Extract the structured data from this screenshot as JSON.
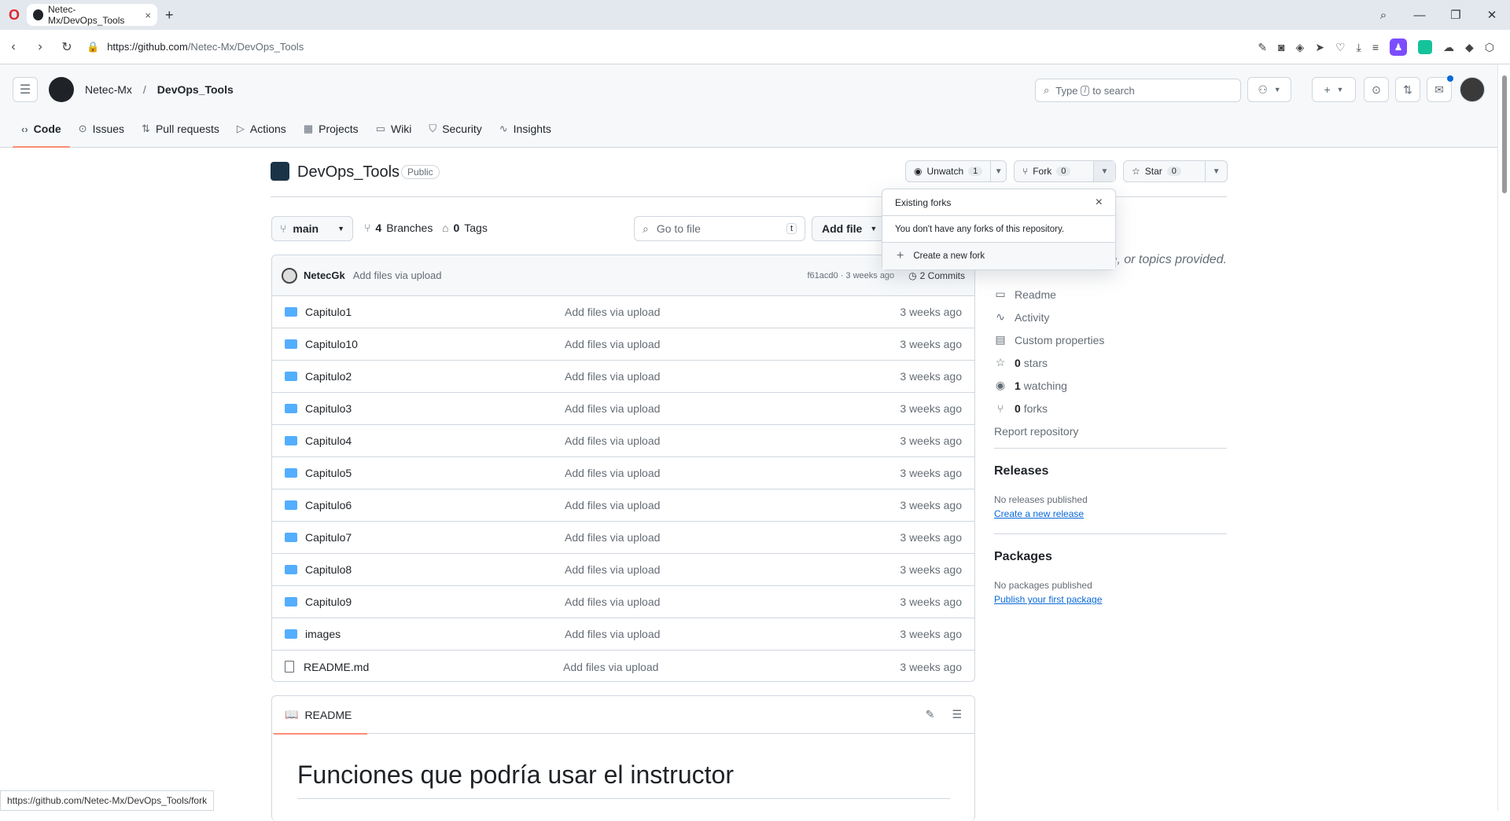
{
  "browser": {
    "tab_title": "Netec-Mx/DevOps_Tools",
    "url_host": "https://github.com",
    "url_path": "/Netec-Mx/DevOps_Tools",
    "status_url": "https://github.com/Netec-Mx/DevOps_Tools/fork"
  },
  "header": {
    "owner": "Netec-Mx",
    "separator": "/",
    "repo": "DevOps_Tools",
    "search_prefix": "Type",
    "search_key": "/",
    "search_suffix": "to search"
  },
  "nav": [
    {
      "label": "Code",
      "icon": "code-icon"
    },
    {
      "label": "Issues",
      "icon": "issue-icon"
    },
    {
      "label": "Pull requests",
      "icon": "pull-request-icon"
    },
    {
      "label": "Actions",
      "icon": "play-icon"
    },
    {
      "label": "Projects",
      "icon": "table-icon"
    },
    {
      "label": "Wiki",
      "icon": "book-icon"
    },
    {
      "label": "Security",
      "icon": "shield-icon"
    },
    {
      "label": "Insights",
      "icon": "graph-icon"
    }
  ],
  "repo": {
    "name": "DevOps_Tools",
    "visibility": "Public",
    "unwatch_label": "Unwatch",
    "watch_count": "1",
    "fork_label": "Fork",
    "fork_count": "0",
    "star_label": "Star",
    "star_count": "0"
  },
  "branchbar": {
    "branch": "main",
    "branches_count": "4",
    "branches_label": "Branches",
    "tags_count": "0",
    "tags_label": "Tags",
    "goto_placeholder": "Go to file",
    "goto_key": "t",
    "add_file": "Add file"
  },
  "commit": {
    "author": "NetecGk",
    "message": "Add files via upload",
    "sha_age": "f61acd0 · 3 weeks ago",
    "commits": "2 Commits"
  },
  "files": [
    {
      "name": "Capitulo1",
      "type": "folder",
      "message": "Add files via upload",
      "age": "3 weeks ago"
    },
    {
      "name": "Capitulo10",
      "type": "folder",
      "message": "Add files via upload",
      "age": "3 weeks ago"
    },
    {
      "name": "Capitulo2",
      "type": "folder",
      "message": "Add files via upload",
      "age": "3 weeks ago"
    },
    {
      "name": "Capitulo3",
      "type": "folder",
      "message": "Add files via upload",
      "age": "3 weeks ago"
    },
    {
      "name": "Capitulo4",
      "type": "folder",
      "message": "Add files via upload",
      "age": "3 weeks ago"
    },
    {
      "name": "Capitulo5",
      "type": "folder",
      "message": "Add files via upload",
      "age": "3 weeks ago"
    },
    {
      "name": "Capitulo6",
      "type": "folder",
      "message": "Add files via upload",
      "age": "3 weeks ago"
    },
    {
      "name": "Capitulo7",
      "type": "folder",
      "message": "Add files via upload",
      "age": "3 weeks ago"
    },
    {
      "name": "Capitulo8",
      "type": "folder",
      "message": "Add files via upload",
      "age": "3 weeks ago"
    },
    {
      "name": "Capitulo9",
      "type": "folder",
      "message": "Add files via upload",
      "age": "3 weeks ago"
    },
    {
      "name": "images",
      "type": "folder",
      "message": "Add files via upload",
      "age": "3 weeks ago"
    },
    {
      "name": "README.md",
      "type": "file",
      "message": "Add files via upload",
      "age": "3 weeks ago"
    }
  ],
  "readme": {
    "tab": "README",
    "heading": "Funciones que podría usar el instructor"
  },
  "about": {
    "desc_fragment": "e, or topics provided.",
    "readme": "Readme",
    "activity": "Activity",
    "custom_properties": "Custom properties",
    "stars_count": "0",
    "stars_label": "stars",
    "watching_count": "1",
    "watching_label": "watching",
    "forks_count": "0",
    "forks_label": "forks",
    "report": "Report repository"
  },
  "releases": {
    "title": "Releases",
    "empty": "No releases published",
    "link": "Create a new release"
  },
  "packages": {
    "title": "Packages",
    "empty": "No packages published",
    "link": "Publish your first package"
  },
  "fork_popup": {
    "title": "Existing forks",
    "message": "You don't have any forks of this repository.",
    "action": "Create a new fork"
  }
}
